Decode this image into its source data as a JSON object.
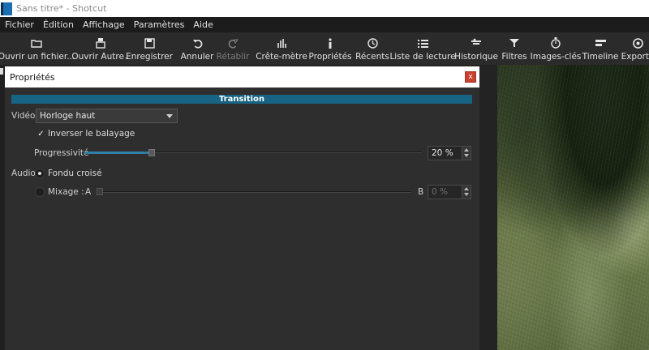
{
  "window": {
    "title": "Sans titre* - Shotcut"
  },
  "menu": [
    "Fichier",
    "Édition",
    "Affichage",
    "Paramètres",
    "Aide"
  ],
  "toolbar": [
    {
      "label": "Ouvrir un fichier...",
      "icon": "folder-open-icon"
    },
    {
      "label": "Ouvrir Autre",
      "icon": "open-other-icon"
    },
    {
      "label": "Enregistrer",
      "icon": "save-icon"
    },
    {
      "label": "Annuler",
      "icon": "undo-icon"
    },
    {
      "label": "Rétablir",
      "icon": "redo-icon",
      "disabled": true
    },
    {
      "label": "Crête-mètre",
      "icon": "peak-meter-icon"
    },
    {
      "label": "Propriétés",
      "icon": "info-icon"
    },
    {
      "label": "Récents",
      "icon": "clock-icon"
    },
    {
      "label": "Liste de lecture",
      "icon": "list-icon"
    },
    {
      "label": "Historique",
      "icon": "history-icon"
    },
    {
      "label": "Filtres",
      "icon": "filter-icon"
    },
    {
      "label": "Images-clés",
      "icon": "stopwatch-icon"
    },
    {
      "label": "Timeline",
      "icon": "timeline-icon"
    },
    {
      "label": "Exporte",
      "icon": "export-icon"
    }
  ],
  "panel": {
    "title": "Propriétés",
    "close": "x",
    "section": "Transition",
    "video": {
      "label": "Vidéo",
      "selected": "Horloge haut",
      "invert_label": "Inverser le balayage",
      "invert_checked": true,
      "invert_check": "✓",
      "progress_label": "Progressivité",
      "progress_value": "20 %",
      "progress_fraction": 0.2
    },
    "audio": {
      "label": "Audio",
      "crossfade_label": "Fondu croisé",
      "crossfade_selected": true,
      "mix_label": "Mixage :",
      "a": "A",
      "b": "B",
      "mix_value": "0 %",
      "mix_fraction": 0.0
    }
  },
  "colors": {
    "accent": "#176383",
    "close": "#c9412f"
  }
}
